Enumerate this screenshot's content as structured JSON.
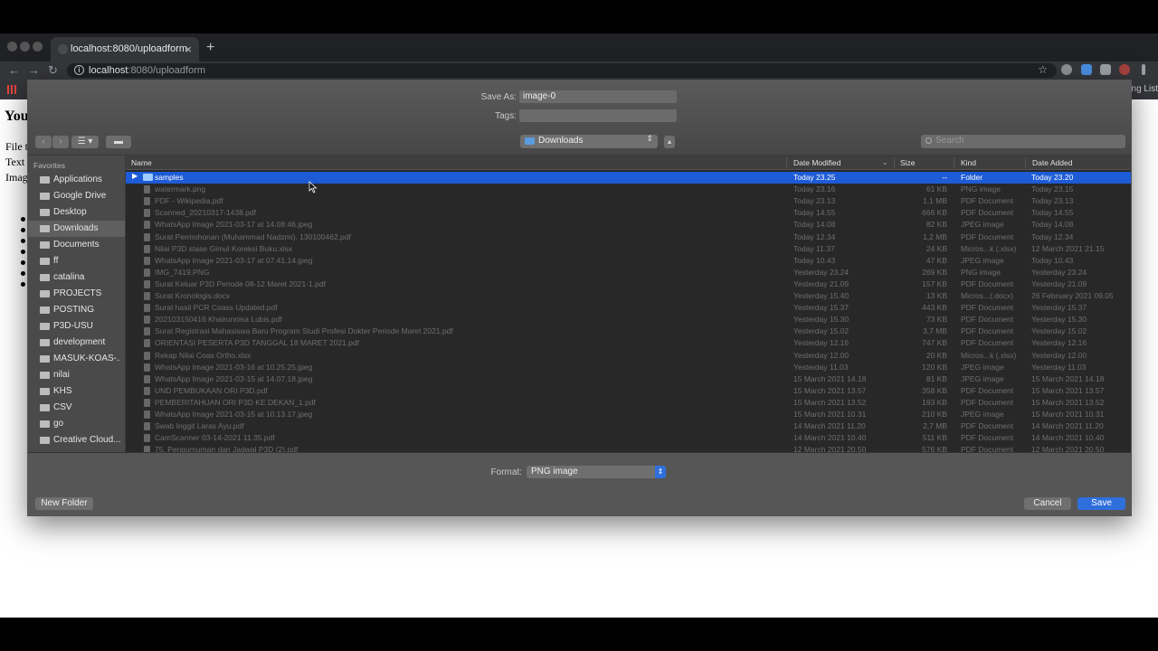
{
  "browser": {
    "tab_title": "localhost:8080/uploadform",
    "url_host": "localhost",
    "url_rest": ":8080/uploadform",
    "bookmark_right": "ing List"
  },
  "page": {
    "title": "You",
    "lines": [
      "File t",
      "Text T",
      "Imag"
    ]
  },
  "dialog": {
    "save_as_label": "Save As:",
    "save_as_value": "image-0",
    "tags_label": "Tags:",
    "tags_value": "",
    "location": "Downloads",
    "search_placeholder": "Search",
    "favorites_header": "Favorites",
    "sidebar_items": [
      {
        "label": "Applications",
        "icon": "applications-icon"
      },
      {
        "label": "Google Drive",
        "icon": "folder-icon"
      },
      {
        "label": "Desktop",
        "icon": "desktop-icon"
      },
      {
        "label": "Downloads",
        "icon": "downloads-icon",
        "selected": true
      },
      {
        "label": "Documents",
        "icon": "documents-icon"
      },
      {
        "label": "ff",
        "icon": "home-icon"
      },
      {
        "label": "catalina",
        "icon": "folder-icon"
      },
      {
        "label": "PROJECTS",
        "icon": "folder-icon"
      },
      {
        "label": "POSTING",
        "icon": "folder-icon"
      },
      {
        "label": "P3D-USU",
        "icon": "folder-icon"
      },
      {
        "label": "development",
        "icon": "folder-icon"
      },
      {
        "label": "MASUK-KOAS-...",
        "icon": "folder-icon"
      },
      {
        "label": "nilai",
        "icon": "folder-icon"
      },
      {
        "label": "KHS",
        "icon": "folder-icon"
      },
      {
        "label": "CSV",
        "icon": "folder-icon"
      },
      {
        "label": "go",
        "icon": "folder-icon"
      },
      {
        "label": "Creative Cloud...",
        "icon": "folder-icon"
      }
    ],
    "columns": [
      "Name",
      "Date Modified",
      "Size",
      "Kind",
      "Date Added"
    ],
    "files": [
      {
        "name": "samples",
        "modified": "Today 23.25",
        "size": "--",
        "kind": "Folder",
        "added": "Today 23.20",
        "selected": true
      },
      {
        "name": "watermark.png",
        "modified": "Today 23.16",
        "size": "61 KB",
        "kind": "PNG image",
        "added": "Today 23.15"
      },
      {
        "name": "PDF - Wikipedia.pdf",
        "modified": "Today 23.13",
        "size": "1,1 MB",
        "kind": "PDF Document",
        "added": "Today 23.13"
      },
      {
        "name": "Scanned_20210317-1438.pdf",
        "modified": "Today 14.55",
        "size": "666 KB",
        "kind": "PDF Document",
        "added": "Today 14.55"
      },
      {
        "name": "WhatsApp Image 2021-03-17 at 14.08.46.jpeg",
        "modified": "Today 14.08",
        "size": "82 KB",
        "kind": "JPEG image",
        "added": "Today 14.08"
      },
      {
        "name": "Surat Permohonan (Muhammad Nadzmi). 130100462.pdf",
        "modified": "Today 12.34",
        "size": "1,2 MB",
        "kind": "PDF Document",
        "added": "Today 12.34"
      },
      {
        "name": "Nilai P3D stase Gimul Koreksi Buku.xlsx",
        "modified": "Today 11.37",
        "size": "24 KB",
        "kind": "Micros...k (.xlsx)",
        "added": "12 March 2021 21.15"
      },
      {
        "name": "WhatsApp Image 2021-03-17 at 07.41.14.jpeg",
        "modified": "Today 10.43",
        "size": "47 KB",
        "kind": "JPEG image",
        "added": "Today 10.43"
      },
      {
        "name": "IMG_7419.PNG",
        "modified": "Yesterday 23.24",
        "size": "269 KB",
        "kind": "PNG image",
        "added": "Yesterday 23.24"
      },
      {
        "name": "Surat Keluar P3D Periode 08-12 Maret 2021-1.pdf",
        "modified": "Yesterday 21.09",
        "size": "157 KB",
        "kind": "PDF Document",
        "added": "Yesterday 21.09"
      },
      {
        "name": "Surat Kronologis.docx",
        "modified": "Yesterday 15.40",
        "size": "13 KB",
        "kind": "Micros...(.docx)",
        "added": "26 February 2021 09.05"
      },
      {
        "name": "Surat hasil PCR Coass Updated.pdf",
        "modified": "Yesterday 15.37",
        "size": "443 KB",
        "kind": "PDF Document",
        "added": "Yesterday 15.37"
      },
      {
        "name": "202103150416 Khairunnisa Lubis.pdf",
        "modified": "Yesterday 15.30",
        "size": "73 KB",
        "kind": "PDF Document",
        "added": "Yesterday 15.30"
      },
      {
        "name": "Surat Registrasi Mahasiswa Baru Program Studi Profesi Dokter Periode Maret 2021.pdf",
        "modified": "Yesterday 15.02",
        "size": "3,7 MB",
        "kind": "PDF Document",
        "added": "Yesterday 15.02"
      },
      {
        "name": "ORIENTASI PESERTA P3D TANGGAL 18 MARET 2021.pdf",
        "modified": "Yesterday 12.16",
        "size": "747 KB",
        "kind": "PDF Document",
        "added": "Yesterday 12.16"
      },
      {
        "name": "Rekap Nilai Coas Ortho.xlsx",
        "modified": "Yesterday 12.00",
        "size": "20 KB",
        "kind": "Micros...k (.xlsx)",
        "added": "Yesterday 12.00"
      },
      {
        "name": "WhatsApp Image 2021-03-16 at 10.25.25.jpeg",
        "modified": "Yesterday 11.03",
        "size": "120 KB",
        "kind": "JPEG image",
        "added": "Yesterday 11.03"
      },
      {
        "name": "WhatsApp Image 2021-03-15 at 14.07.18.jpeg",
        "modified": "15 March 2021 14.18",
        "size": "81 KB",
        "kind": "JPEG image",
        "added": "15 March 2021 14.18"
      },
      {
        "name": "UND PEMBUKAAN ORI P3D.pdf",
        "modified": "15 March 2021 13.57",
        "size": "358 KB",
        "kind": "PDF Document",
        "added": "15 March 2021 13.57"
      },
      {
        "name": "PEMBERITAHUAN ORI P3D KE DEKAN_1.pdf",
        "modified": "15 March 2021 13.52",
        "size": "193 KB",
        "kind": "PDF Document",
        "added": "15 March 2021 13.52"
      },
      {
        "name": "WhatsApp Image 2021-03-15 at 10.13.17.jpeg",
        "modified": "15 March 2021 10.31",
        "size": "210 KB",
        "kind": "JPEG image",
        "added": "15 March 2021 10.31"
      },
      {
        "name": "Swab Inggit Laras Ayu.pdf",
        "modified": "14 March 2021 11.20",
        "size": "2,7 MB",
        "kind": "PDF Document",
        "added": "14 March 2021 11.20"
      },
      {
        "name": "CamScanner 03-14-2021 11.35.pdf",
        "modified": "14 March 2021 10.40",
        "size": "511 KB",
        "kind": "PDF Document",
        "added": "14 March 2021 10.40"
      },
      {
        "name": "75. Pengumuman dan Jadwal P3D (2).pdf",
        "modified": "12 March 2021 20.50",
        "size": "576 KB",
        "kind": "PDF Document",
        "added": "12 March 2021 20.50"
      }
    ],
    "format_label": "Format:",
    "format_value": "PNG image",
    "new_folder_label": "New Folder",
    "cancel_label": "Cancel",
    "save_label": "Save"
  },
  "colors": {
    "selection": "#1e5bd6",
    "save_button": "#2f6fdc"
  }
}
